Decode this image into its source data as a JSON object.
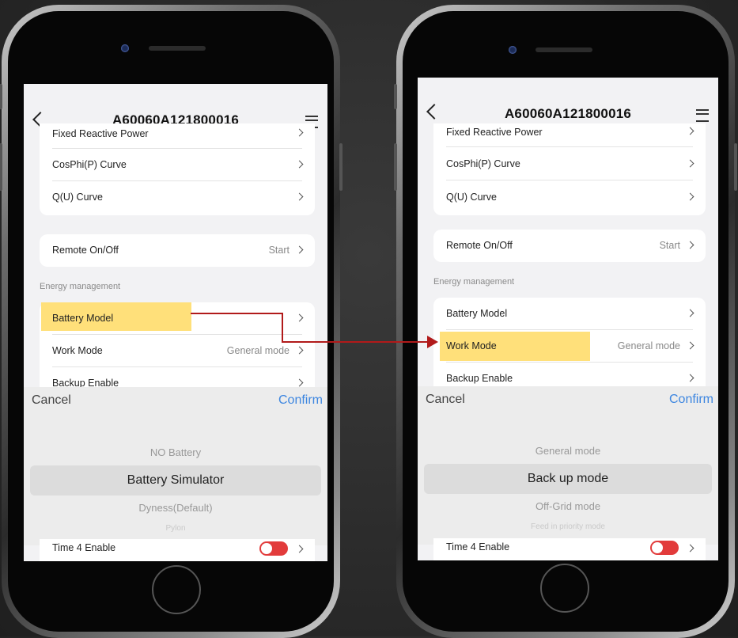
{
  "left": {
    "header": {
      "title": "A60060A121800016"
    },
    "items": {
      "fixed_reactive_power": "Fixed Reactive Power",
      "cosphi_curve": "CosPhi(P) Curve",
      "qu_curve": "Q(U) Curve",
      "remote_onoff": "Remote On/Off",
      "remote_onoff_value": "Start",
      "section_energy": "Energy management",
      "battery_model": "Battery Model",
      "work_mode": "Work Mode",
      "work_mode_value": "General mode",
      "backup_enable": "Backup Enable",
      "time4_enable": "Time 4 Enable"
    },
    "picker": {
      "cancel": "Cancel",
      "confirm": "Confirm",
      "options": [
        "NO Battery",
        "Battery Simulator",
        "Dyness(Default)",
        "Pylon"
      ],
      "selected_index": 1
    }
  },
  "right": {
    "header": {
      "title": "A60060A121800016"
    },
    "items": {
      "fixed_reactive_power": "Fixed Reactive Power",
      "cosphi_curve": "CosPhi(P) Curve",
      "qu_curve": "Q(U) Curve",
      "remote_onoff": "Remote On/Off",
      "remote_onoff_value": "Start",
      "section_energy": "Energy management",
      "battery_model": "Battery Model",
      "work_mode": "Work Mode",
      "work_mode_value": "General mode",
      "backup_enable": "Backup Enable",
      "time4_enable": "Time 4 Enable"
    },
    "picker": {
      "cancel": "Cancel",
      "confirm": "Confirm",
      "options": [
        "General mode",
        "Back up mode",
        "Off-Grid mode",
        "Feed in priority mode"
      ],
      "selected_index": 1
    }
  },
  "colors": {
    "highlight": "#ffe07a",
    "arrow": "#b11a1a",
    "confirm": "#3d86e0",
    "toggle": "#e23b3b"
  },
  "icons": [
    "back-chevron-icon",
    "hamburger-menu-icon",
    "chevron-right-icon",
    "toggle-switch-icon",
    "connector-arrow-icon"
  ]
}
